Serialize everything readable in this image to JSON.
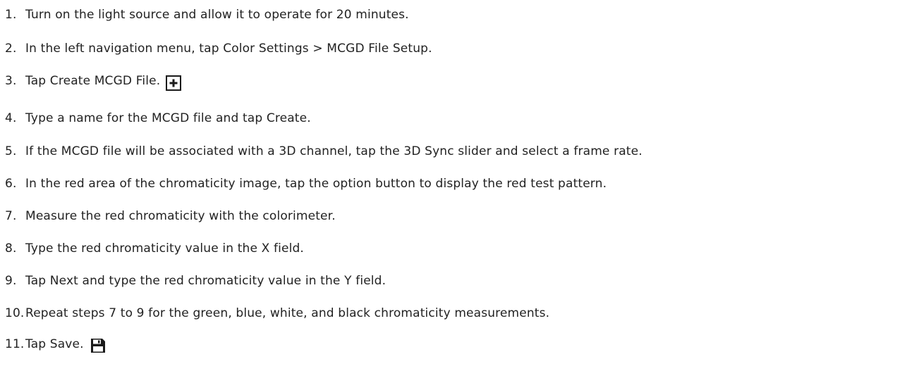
{
  "steps": [
    {
      "number": "1.",
      "text": "Turn on the light source and allow it to operate for 20 minutes."
    },
    {
      "number": "2.",
      "pre": "In the left navigation menu, tap ",
      "ui": "Color Settings > MCGD File Setup",
      "post": "."
    },
    {
      "number": "3.",
      "pre": "Tap ",
      "ui": "Create MCGD File",
      "post": ".",
      "icon": "plus-square-icon"
    },
    {
      "number": "4.",
      "pre": "Type a name for the MCGD file and tap ",
      "ui": "Create",
      "post": "."
    },
    {
      "number": "5.",
      "pre": "If the MCGD file will be associated with a 3D channel, tap the ",
      "ui": "3D Sync",
      "post": " slider and select a frame rate."
    },
    {
      "number": "6.",
      "text": "In the red area of the chromaticity image, tap the option button to display the red test pattern."
    },
    {
      "number": "7.",
      "text": "Measure the red chromaticity with the colorimeter."
    },
    {
      "number": "8.",
      "pre": "Type the red chromaticity value in the ",
      "ui": "X",
      "post": " field."
    },
    {
      "number": "9.",
      "pre": "Tap ",
      "ui": "Next",
      "post": " and type the red chromaticity value in the ",
      "ui2": "Y",
      "post2": " field."
    },
    {
      "number": "10.",
      "text": "Repeat steps 7 to 9 for the green, blue, white, and black chromaticity measurements."
    },
    {
      "number": "11.",
      "pre": "Tap ",
      "ui": "Save",
      "post": ".",
      "icon": "save-floppy-icon"
    }
  ],
  "colors": {
    "text": "#222222",
    "icon": "#1a1a1a"
  }
}
